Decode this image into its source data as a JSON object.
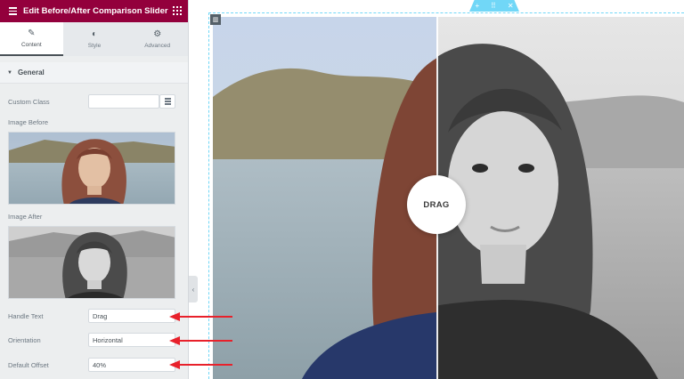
{
  "header": {
    "title": "Edit Before/After Comparison Slider",
    "menu_icon": "hamburger-icon",
    "grid_icon": "grid-icon",
    "color": "#93003c"
  },
  "tabs": [
    {
      "label": "Content",
      "icon": "pencil-icon",
      "active": true
    },
    {
      "label": "Style",
      "icon": "contrast-icon",
      "active": false
    },
    {
      "label": "Advanced",
      "icon": "gear-icon",
      "active": false
    }
  ],
  "section": {
    "title": "General"
  },
  "controls": {
    "custom_class": {
      "label": "Custom Class",
      "value": "",
      "icon": "list-icon"
    },
    "image_before": {
      "label": "Image Before"
    },
    "image_after": {
      "label": "Image After"
    },
    "handle_text": {
      "label": "Handle Text",
      "value": "Drag"
    },
    "orientation": {
      "label": "Orientation",
      "value": "Horizontal"
    },
    "default_offset": {
      "label": "Default Offset",
      "value": "40%"
    }
  },
  "toolbar": {
    "add_icon": "plus-icon",
    "move_icon": "drag-dots-icon",
    "close_icon": "close-icon",
    "color": "#71d7f7"
  },
  "preview": {
    "handle_label": "DRAG",
    "default_offset": 0.4
  },
  "annotations": {
    "arrow_color": "#e8212b"
  }
}
